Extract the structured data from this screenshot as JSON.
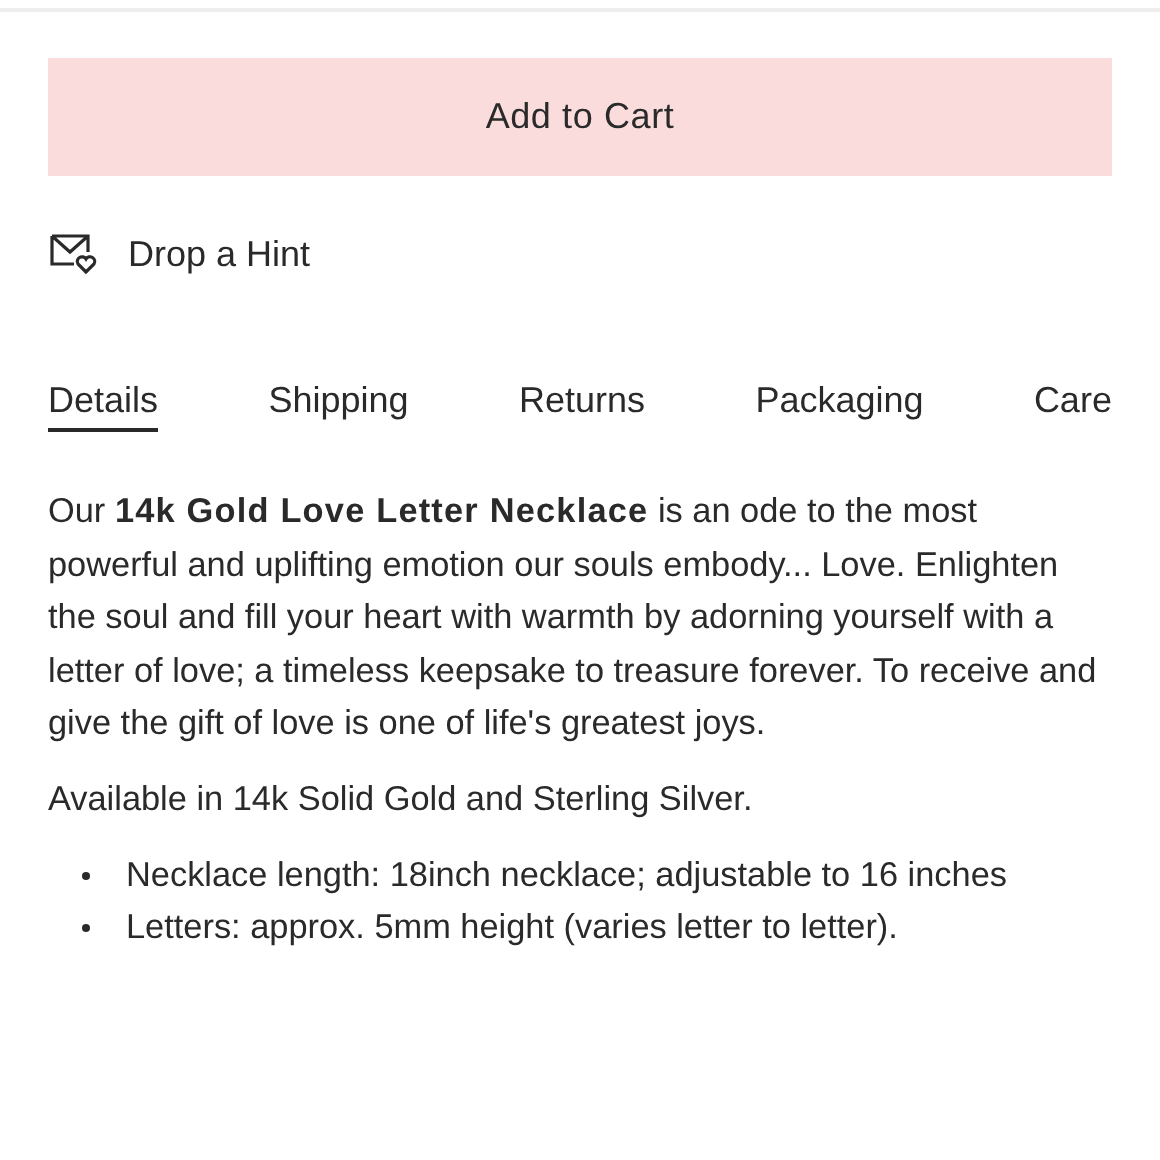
{
  "add_to_cart_button": "Add to Cart",
  "hint_link": "Drop a Hint",
  "tabs": [
    {
      "label": "Details",
      "selected": true
    },
    {
      "label": "Shipping",
      "selected": false
    },
    {
      "label": "Returns",
      "selected": false
    },
    {
      "label": "Packaging",
      "selected": false
    },
    {
      "label": "Care",
      "selected": false
    }
  ],
  "description": "Our **14k Gold Love Letter Necklace** is an ode to the most powerful and uplifting emotion our souls embody... Love. Enlighten the soul and fill your heart with warmth by adorning yourself with a letter of love; a timeless keepsake to treasure forever. To receive and give the gift of love is one of life's greatest joys.",
  "availability": "Available in 14k Solid Gold and Sterling Silver.",
  "features": [
    "Necklace length: 18inch necklace; adjustable to 16 inches",
    "Letters: approx. 5mm height (varies letter to letter)."
  ]
}
